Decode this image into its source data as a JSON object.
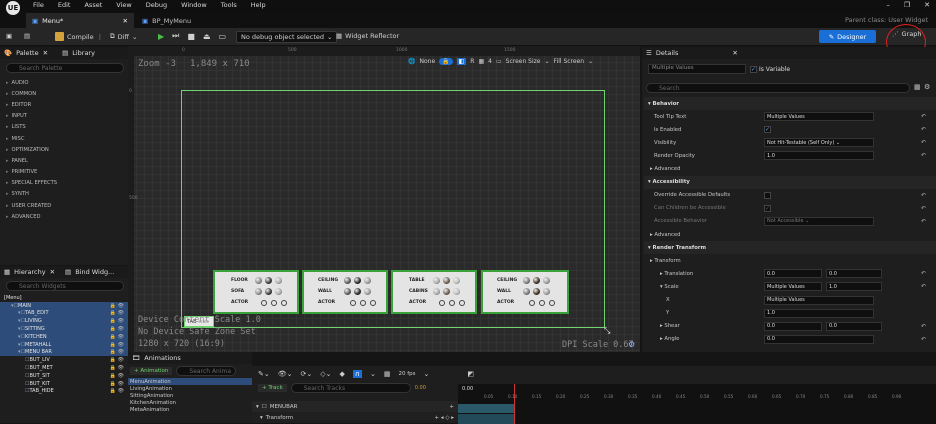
{
  "app": {
    "logo": "UE",
    "menus": [
      "File",
      "Edit",
      "Asset",
      "View",
      "Debug",
      "Window",
      "Tools",
      "Help"
    ],
    "window_controls": [
      "–",
      "❐",
      "✕"
    ]
  },
  "tabs": [
    {
      "label": "Menu*",
      "active": true
    },
    {
      "label": "BP_MyMenu",
      "active": false
    }
  ],
  "parent_class": "Parent class: User Widget",
  "toolbar": {
    "compile": "Compile",
    "diff": "Diff",
    "debug_object": "No debug object selected",
    "widget_reflector": "Widget Reflector",
    "designer": "Designer",
    "graph": "Graph"
  },
  "palette": {
    "title": "Palette",
    "library": "Library",
    "search_placeholder": "Search Palette",
    "categories": [
      "AUDIO",
      "COMMON",
      "EDITOR",
      "INPUT",
      "LISTS",
      "MISC",
      "OPTIMIZATION",
      "PANEL",
      "PRIMITIVE",
      "SPECIAL EFFECTS",
      "SYNTH",
      "USER CREATED",
      "ADVANCED"
    ]
  },
  "hierarchy": {
    "title": "Hierarchy",
    "bind": "Bind Widg...",
    "search_placeholder": "Search Widgets",
    "items": [
      {
        "label": "[Menu]",
        "indent": 0,
        "sel": false
      },
      {
        "label": "MAIN",
        "indent": 1,
        "sel": true
      },
      {
        "label": "TAB_EDIT",
        "indent": 2,
        "sel": true
      },
      {
        "label": "LIVING",
        "indent": 2,
        "sel": true
      },
      {
        "label": "SITTING",
        "indent": 2,
        "sel": true
      },
      {
        "label": "KITCHEN",
        "indent": 2,
        "sel": true
      },
      {
        "label": "METAHALL",
        "indent": 2,
        "sel": true
      },
      {
        "label": "MENU BAR",
        "indent": 2,
        "sel": true
      },
      {
        "label": "BUT_LIV",
        "indent": 3,
        "sel": false
      },
      {
        "label": "BUT_MET",
        "indent": 3,
        "sel": false
      },
      {
        "label": "BUT_SIT",
        "indent": 3,
        "sel": false
      },
      {
        "label": "BUT_KIT",
        "indent": 3,
        "sel": false
      },
      {
        "label": "TAB_HIDE",
        "indent": 3,
        "sel": false
      }
    ]
  },
  "canvas": {
    "zoom": "Zoom -3",
    "size": "1,849 x 710",
    "device": "Device Content Scale 1.0",
    "safe": "No Device Safe Zone Set",
    "res": "1280 x 720 (16:9)",
    "dpi": "DPI Scale 0.67",
    "none": "None",
    "r": "R",
    "grid": "4",
    "screen_size": "Screen Size",
    "fill_screen": "Fill Screen",
    "ruler_0": "0",
    "ruler_500": "500",
    "ruler_1000": "1000",
    "ruler_1500": "1500",
    "vruler_0": "0",
    "vruler_500": "500",
    "tab_label": "TAB",
    "tooltip_suffix": "scale",
    "cards": [
      {
        "rows": [
          "FLOOR",
          "SOFA",
          "ACTOR"
        ]
      },
      {
        "rows": [
          "CEILING",
          "WALL",
          "ACTOR"
        ]
      },
      {
        "rows": [
          "TABLE",
          "CABINS",
          "ACTOR"
        ]
      },
      {
        "rows": [
          "CEILING",
          "WALL",
          "ACTOR"
        ]
      }
    ]
  },
  "details": {
    "title": "Details",
    "name": "Multiple Values",
    "is_variable": "Is Variable",
    "search_placeholder": "Search",
    "rows": [
      {
        "label": "Behavior",
        "section": true
      },
      {
        "label": "Tool Tip Text",
        "value": "Multiple Values"
      },
      {
        "label": "Is Enabled",
        "check": true
      },
      {
        "label": "Visibility",
        "value": "Not Hit-Testable (Self Only) ⌄"
      },
      {
        "label": "Render Opacity",
        "value": "1.0"
      },
      {
        "label": "Advanced",
        "sub": true
      },
      {
        "label": "Accessibility",
        "section": true
      },
      {
        "label": "Override Accessible Defaults",
        "check": false
      },
      {
        "label": "Can Children be Accessible",
        "check": true,
        "dim": true
      },
      {
        "label": "Accessible Behavior",
        "value": "Not Accessible ⌄",
        "dim": true
      },
      {
        "label": "Advanced",
        "sub": true
      },
      {
        "label": "Render Transform",
        "section": true
      },
      {
        "label": "Transform",
        "sub": true
      },
      {
        "label": "Translation",
        "value": "0.0",
        "value2": "0.0",
        "indent": 1
      },
      {
        "label": "Scale",
        "value": "Multiple Values",
        "value2": "1.0",
        "indent": 1
      },
      {
        "label": "X",
        "value": "Multiple Values",
        "indent": 2
      },
      {
        "label": "Y",
        "value": "1.0",
        "indent": 2
      },
      {
        "label": "Shear",
        "value": "0.0",
        "value2": "0.0",
        "indent": 1
      },
      {
        "label": "Angle",
        "value": "0.0",
        "indent": 1
      }
    ]
  },
  "animations": {
    "title": "Animations",
    "add": "+ Animation",
    "search_placeholder": "Search Anima",
    "items": [
      "MenuAnimation",
      "LivingAnimation",
      "SittingAnimation",
      "KitchenAnimation",
      "MetaAnimation"
    ]
  },
  "timeline": {
    "fps": "20 fps",
    "track": "+ Track",
    "search_tracks": "Search Tracks",
    "time": "0.00",
    "time_field": "0.00",
    "ticks": [
      "0.05",
      "0.10",
      "0.15",
      "0.20",
      "0.25",
      "0.30",
      "0.35",
      "0.40",
      "0.45",
      "0.50",
      "0.55",
      "0.60",
      "0.65",
      "0.70",
      "0.75",
      "0.80",
      "0.85",
      "0.90"
    ],
    "tracks": [
      "MENUBAR",
      "Transform"
    ]
  }
}
